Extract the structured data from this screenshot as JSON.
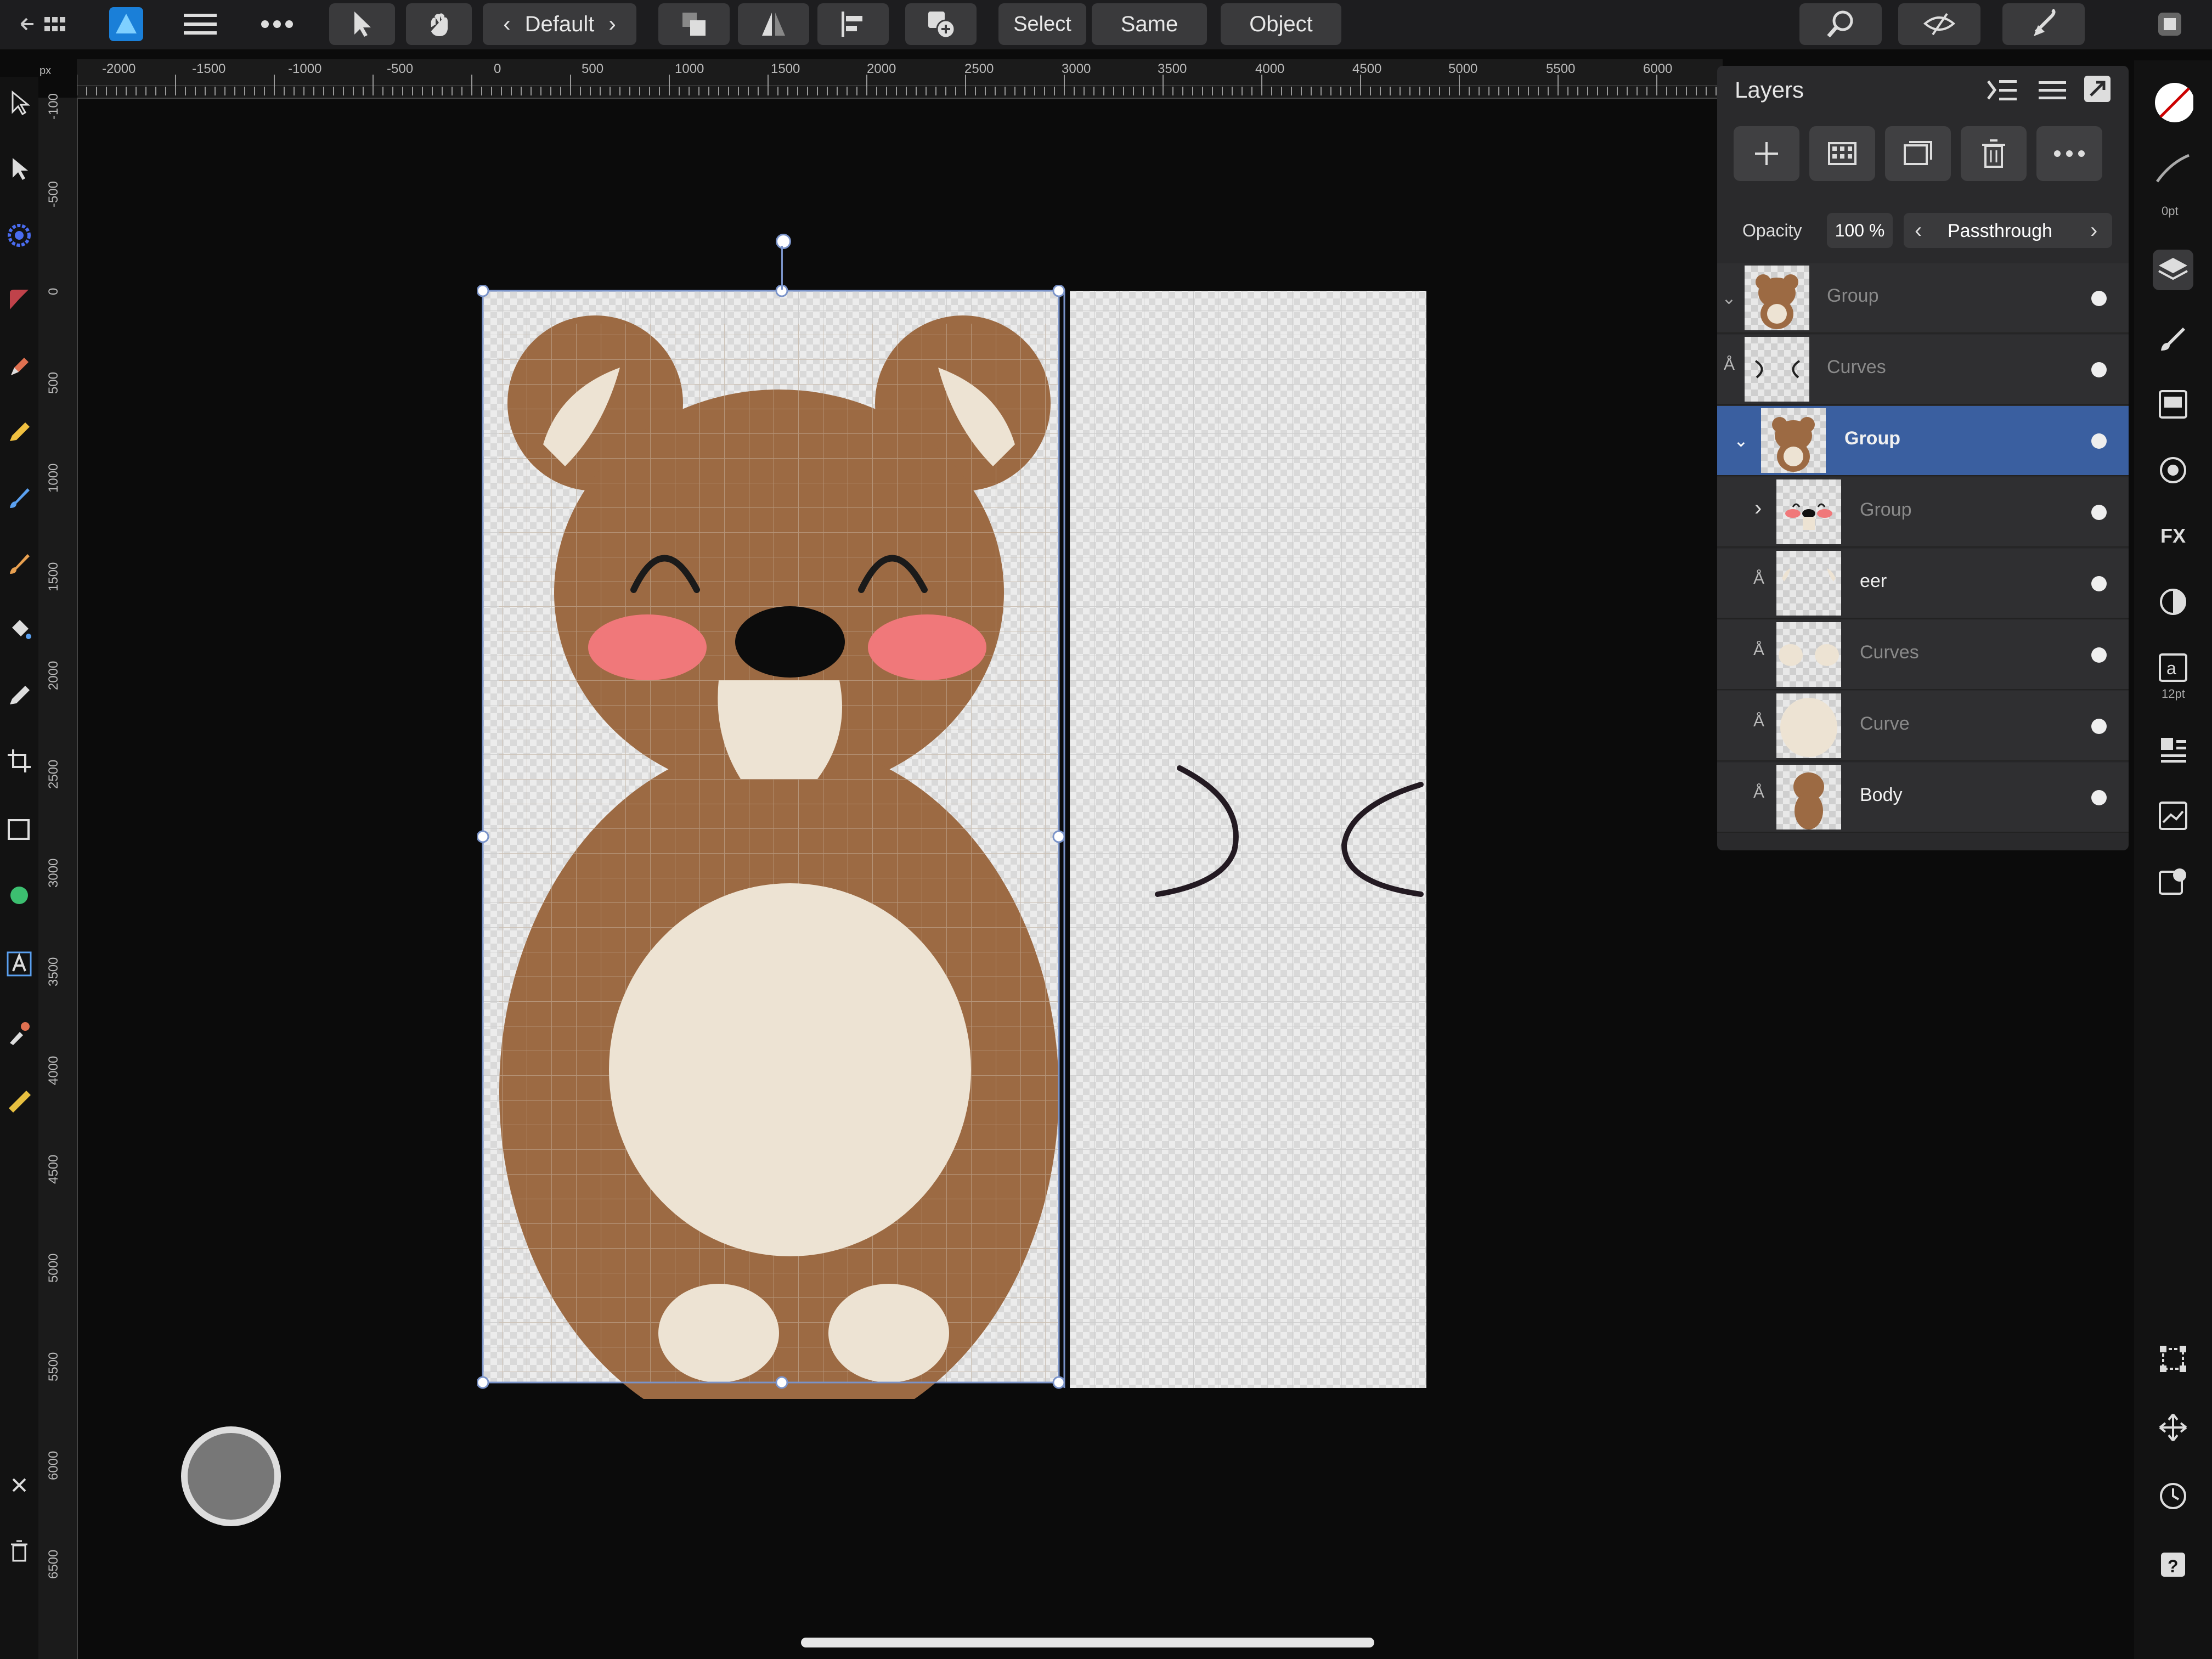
{
  "toolbar": {
    "preset": "Default",
    "select_label": "Select",
    "same_label": "Same",
    "object_label": "Object"
  },
  "ruler": {
    "h_ticks": [
      "-2000",
      "-1500",
      "-1000",
      "-500",
      "0",
      "500",
      "1000",
      "1500",
      "2000",
      "2500",
      "3000",
      "3500",
      "4000",
      "4500",
      "5000",
      "5500",
      "6000"
    ],
    "v_ticks": [
      "-100",
      "-500",
      "0",
      "500",
      "1000",
      "1500",
      "2000",
      "2500",
      "3000",
      "3500",
      "4000",
      "4500",
      "5000",
      "5500",
      "6000",
      "6500"
    ],
    "unit": "px"
  },
  "layers_panel": {
    "title": "Layers",
    "opacity_label": "Opacity",
    "opacity_value": "100 %",
    "blend_mode": "Passthrough",
    "items": [
      {
        "name": "Group",
        "dim": true
      },
      {
        "name": "Curves",
        "dim": true
      },
      {
        "name": "Group",
        "dim": false,
        "selected": true
      },
      {
        "name": "Group",
        "dim": true
      },
      {
        "name": "eer",
        "dim": false
      },
      {
        "name": "Curves",
        "dim": true
      },
      {
        "name": "Curve",
        "dim": true
      },
      {
        "name": "Body",
        "dim": false
      }
    ]
  },
  "right_tools": {
    "stroke_width": "0pt",
    "font_size": "12pt"
  },
  "colors": {
    "bear_brown": "#9c6a43",
    "bear_cream": "#ede3d3",
    "cheek_pink": "#f0787a",
    "selection_blue": "#3a5fa0"
  }
}
